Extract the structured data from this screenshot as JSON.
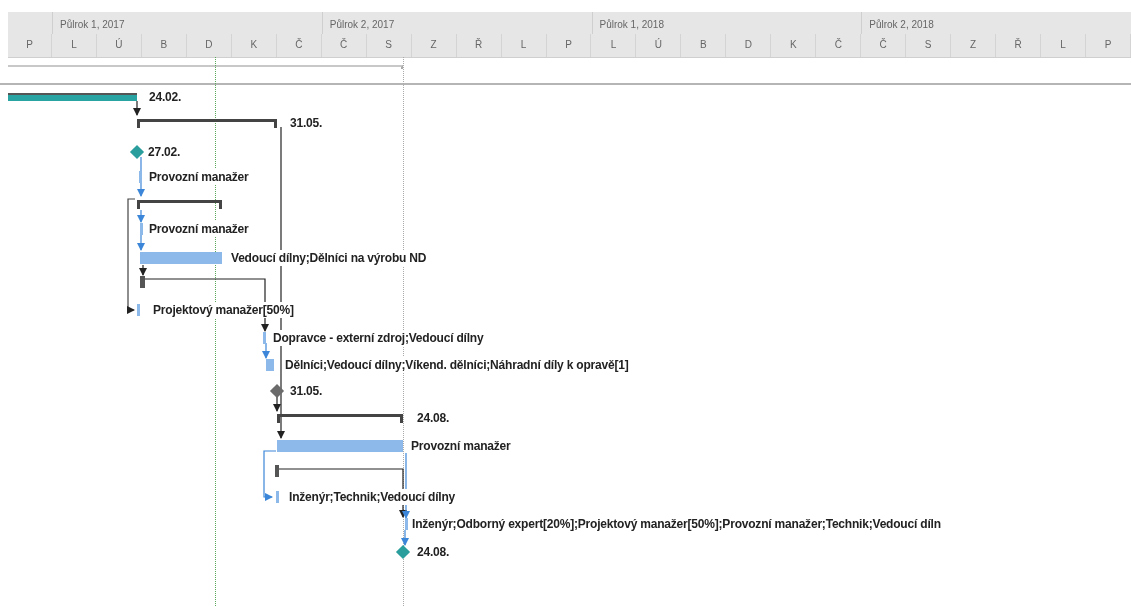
{
  "timescale": {
    "halves": [
      {
        "label": "Půlrok 1, 2017"
      },
      {
        "label": "Půlrok 2, 2017"
      },
      {
        "label": "Půlrok 1, 2018"
      },
      {
        "label": "Půlrok 2, 2018"
      }
    ],
    "months": [
      "P",
      "L",
      "Ú",
      "B",
      "D",
      "K",
      "Č",
      "Č",
      "S",
      "Z",
      "Ř",
      "L",
      "P",
      "L",
      "Ú",
      "B",
      "D",
      "K",
      "Č",
      "Č",
      "S",
      "Z",
      "Ř",
      "L",
      "P"
    ]
  },
  "tasks": [
    {
      "kind": "progress",
      "level": 1,
      "label": "24.02."
    },
    {
      "kind": "summary",
      "label": "31.05."
    },
    {
      "kind": "milestone",
      "color": "#2a9d9d",
      "label": "27.02."
    },
    {
      "kind": "task",
      "label": "Provozní manažer"
    },
    {
      "kind": "summary"
    },
    {
      "kind": "task",
      "label": "Provozní manažer"
    },
    {
      "kind": "task",
      "label": "Vedoucí dílny;Dělníci na výrobu ND"
    },
    {
      "kind": "split"
    },
    {
      "kind": "task",
      "label": "Projektový manažer[50%]"
    },
    {
      "kind": "task",
      "label": "Dopravce - externí zdroj;Vedoucí dílny"
    },
    {
      "kind": "task",
      "label": "Dělníci;Vedoucí dílny;Víkend. dělníci;Náhradní díly k opravě[1]"
    },
    {
      "kind": "milestone",
      "color": "#6b6b6b",
      "label": "31.05."
    },
    {
      "kind": "summary",
      "label": "24.08."
    },
    {
      "kind": "task",
      "label": "Provozní manažer"
    },
    {
      "kind": "split"
    },
    {
      "kind": "task",
      "label": "Inženýr;Technik;Vedoucí dílny"
    },
    {
      "kind": "task",
      "label": "Inženýr;Odborný expert[20%];Projektový manažer[50%];Provozní manažer;Technik;Vedoucí díln"
    },
    {
      "kind": "milestone",
      "color": "#2a9d9d",
      "label": "24.08."
    }
  ]
}
